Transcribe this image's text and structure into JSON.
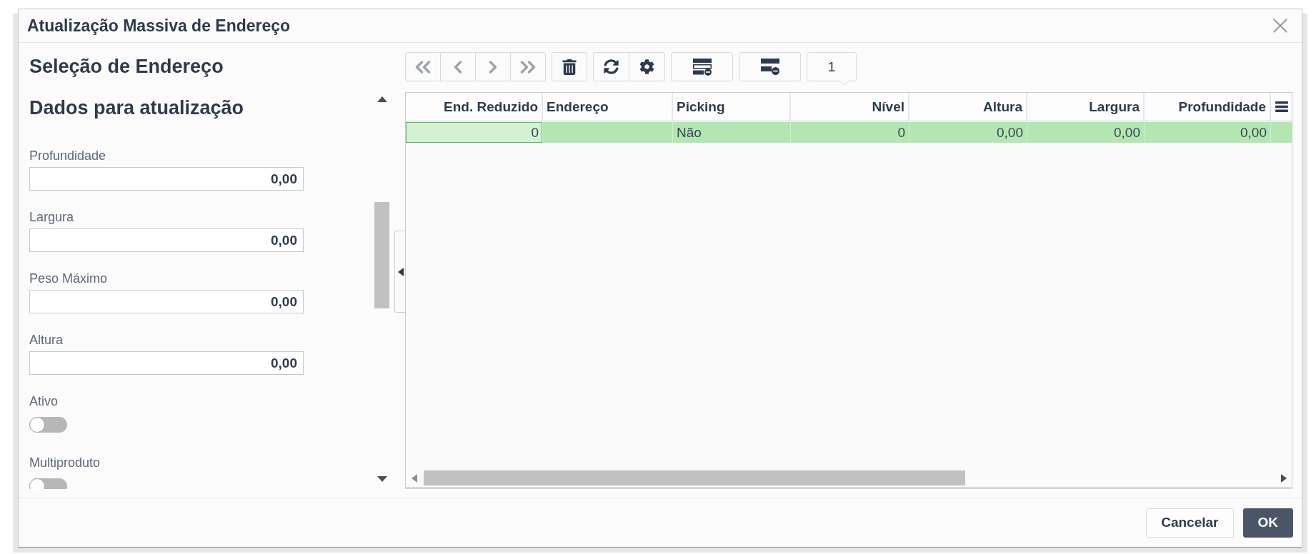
{
  "dialog": {
    "title": "Atualização Massiva de Endereço"
  },
  "form": {
    "title": "Seleção de Endereço",
    "section_title": "Dados para atualização",
    "fields": [
      {
        "kind": "number",
        "label": "Profundidade",
        "value": "0,00"
      },
      {
        "kind": "number",
        "label": "Largura",
        "value": "0,00"
      },
      {
        "kind": "number",
        "label": "Peso Máximo",
        "value": "0,00"
      },
      {
        "kind": "number",
        "label": "Altura",
        "value": "0,00"
      },
      {
        "kind": "toggle",
        "label": "Ativo",
        "on": false
      },
      {
        "kind": "toggle",
        "label": "Multiproduto",
        "on": false
      }
    ]
  },
  "toolbar": {
    "groups": [
      {
        "buttons": [
          {
            "kind": "first",
            "disabled": true
          },
          {
            "kind": "previous",
            "disabled": true
          },
          {
            "kind": "next",
            "disabled": true
          },
          {
            "kind": "last",
            "disabled": true
          }
        ]
      },
      {
        "buttons": [
          {
            "kind": "delete",
            "disabled": false
          }
        ]
      },
      {
        "buttons": [
          {
            "kind": "refresh",
            "disabled": false
          },
          {
            "kind": "settings",
            "disabled": false
          }
        ]
      },
      {
        "buttons": [
          {
            "kind": "stack",
            "disabled": false
          }
        ]
      },
      {
        "buttons": [
          {
            "kind": "halfstack",
            "disabled": false
          }
        ]
      }
    ],
    "page": "1"
  },
  "table": {
    "columns": [
      {
        "label": "End. Reduzido",
        "kind": "number"
      },
      {
        "label": "Endereço",
        "kind": "text"
      },
      {
        "label": "Picking",
        "kind": "text"
      },
      {
        "label": "Nível",
        "kind": "number"
      },
      {
        "label": "Altura",
        "kind": "number"
      },
      {
        "label": "Largura",
        "kind": "number"
      },
      {
        "label": "Profundidade",
        "kind": "number"
      }
    ],
    "rows": [
      {
        "selected": true,
        "cells": [
          {
            "text": "0",
            "focused": true
          },
          {
            "focused": false
          },
          {
            "text": "Não",
            "focused": false
          },
          {
            "text": "0",
            "focused": false
          },
          {
            "text": "0,00",
            "focused": false
          },
          {
            "text": "0,00",
            "focused": false
          },
          {
            "text": "0,00",
            "focused": false
          }
        ]
      }
    ]
  },
  "footer": {
    "buttons": [
      {
        "label": "Cancelar",
        "kind": "secondary"
      },
      {
        "label": "OK",
        "kind": "primary"
      }
    ]
  }
}
